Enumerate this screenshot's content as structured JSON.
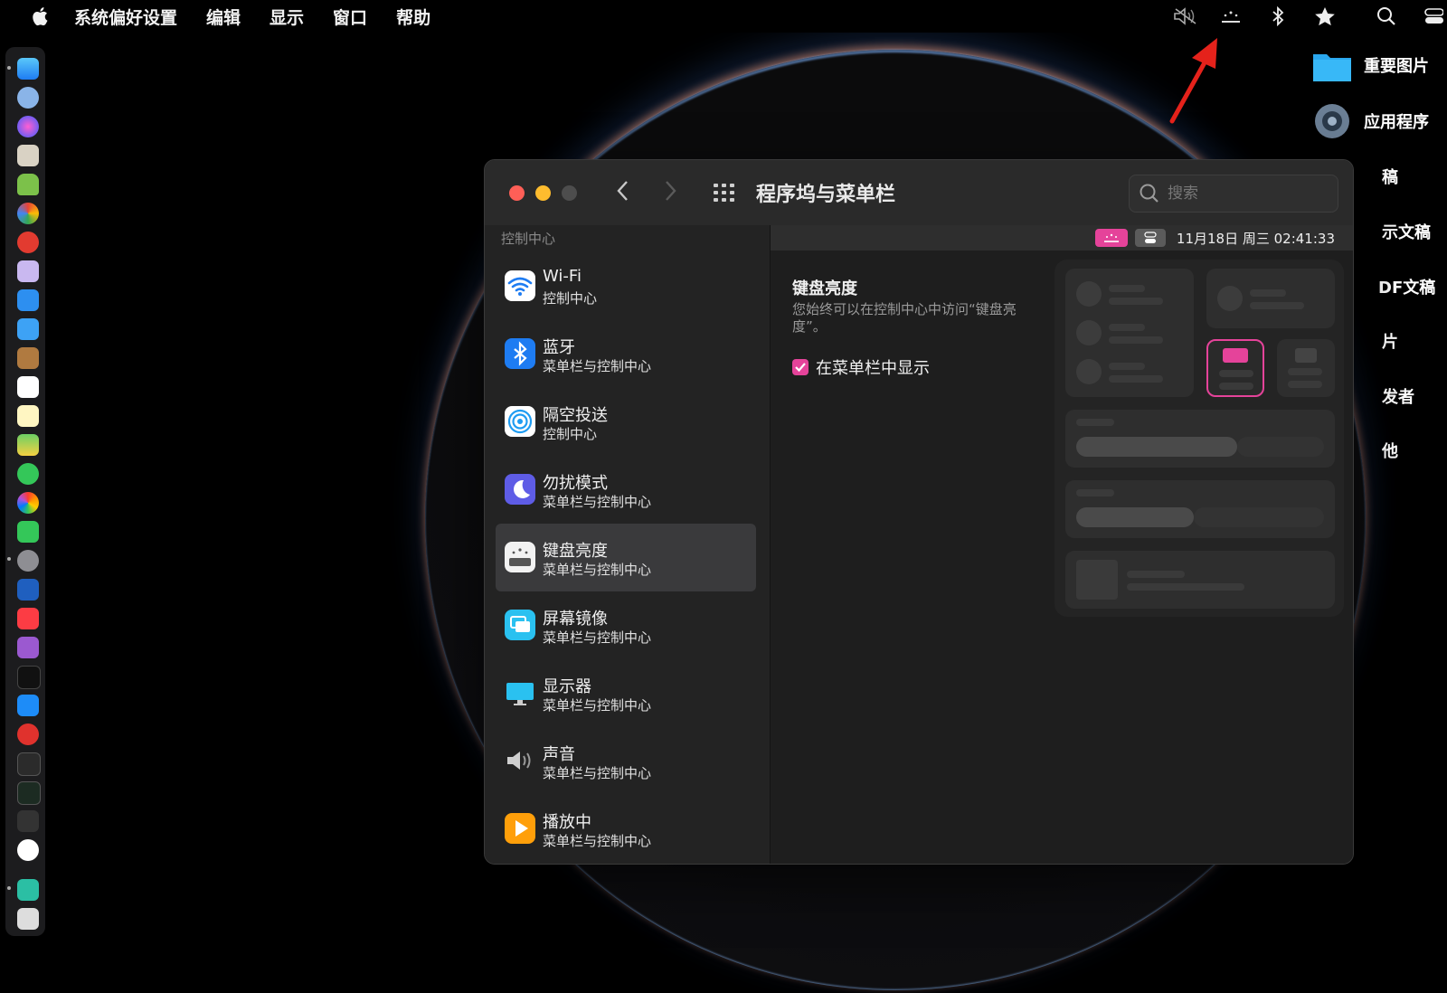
{
  "menubar": {
    "app_name": "系统偏好设置",
    "menus": [
      "编辑",
      "显示",
      "窗口",
      "帮助"
    ]
  },
  "status_icons": [
    "mute-icon",
    "keyboard-brightness-icon",
    "bluetooth-icon",
    "star-icon",
    "search-icon",
    "control-center-icon"
  ],
  "desktop": {
    "items": [
      {
        "label": "重要图片",
        "icon": "folder-icon"
      },
      {
        "label": "应用程序",
        "icon": "apps-icon"
      }
    ],
    "partial_items": [
      "稿",
      "示文稿",
      "DF文稿",
      "片",
      "发者",
      "他"
    ]
  },
  "window": {
    "title": "程序坞与菜单栏",
    "search_placeholder": "搜索",
    "sidebar": {
      "section_label": "控制中心",
      "items": [
        {
          "title": "Wi-Fi",
          "subtitle": "控制中心",
          "icon": "wifi-icon",
          "color": "#ffffff"
        },
        {
          "title": "蓝牙",
          "subtitle": "菜单栏与控制中心",
          "icon": "bluetooth-icon",
          "color": "#1e7cf2"
        },
        {
          "title": "隔空投送",
          "subtitle": "控制中心",
          "icon": "airdrop-icon",
          "color": "#ffffff"
        },
        {
          "title": "勿扰模式",
          "subtitle": "菜单栏与控制中心",
          "icon": "moon-icon",
          "color": "#5e5ce6"
        },
        {
          "title": "键盘亮度",
          "subtitle": "菜单栏与控制中心",
          "icon": "keyboard-brightness-icon",
          "color": "#ffffff"
        },
        {
          "title": "屏幕镜像",
          "subtitle": "菜单栏与控制中心",
          "icon": "screen-mirroring-icon",
          "color": "#2ac1f0"
        },
        {
          "title": "显示器",
          "subtitle": "菜单栏与控制中心",
          "icon": "display-icon",
          "color": "#2ac1f0"
        },
        {
          "title": "声音",
          "subtitle": "菜单栏与控制中心",
          "icon": "speaker-icon",
          "color": "#cfcfcf"
        },
        {
          "title": "播放中",
          "subtitle": "菜单栏与控制中心",
          "icon": "play-icon",
          "color": "#ff9f0a"
        }
      ],
      "selected_index": 4
    },
    "content": {
      "preview_date": "11月18日 周三  02:41:33",
      "heading": "键盘亮度",
      "description": "您始终可以在控制中心中访问“键盘亮度”。",
      "checkbox_label": "在菜单栏中显示",
      "checkbox_checked": true
    }
  },
  "colors": {
    "accent": "#e5439a",
    "close": "#ff5f57",
    "minimize": "#febc2e",
    "zoom_disabled": "#4d4d4d"
  }
}
